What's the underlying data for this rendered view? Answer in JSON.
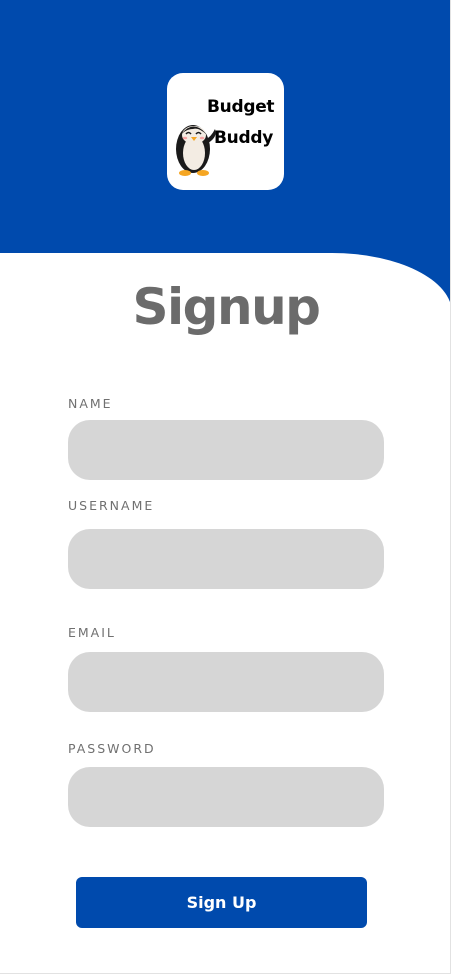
{
  "logo": {
    "line1": "Budget",
    "line2": "Buddy"
  },
  "form": {
    "title": "Signup",
    "fields": [
      {
        "label": "NAME",
        "value": ""
      },
      {
        "label": "USERNAME",
        "value": ""
      },
      {
        "label": "EMAIL",
        "value": ""
      },
      {
        "label": "PASSWORD",
        "value": ""
      }
    ],
    "submit_label": "Sign Up"
  },
  "colors": {
    "brand_blue": "#004aad",
    "field_bg": "#d6d6d6",
    "title_gray": "#6b6b6b"
  }
}
